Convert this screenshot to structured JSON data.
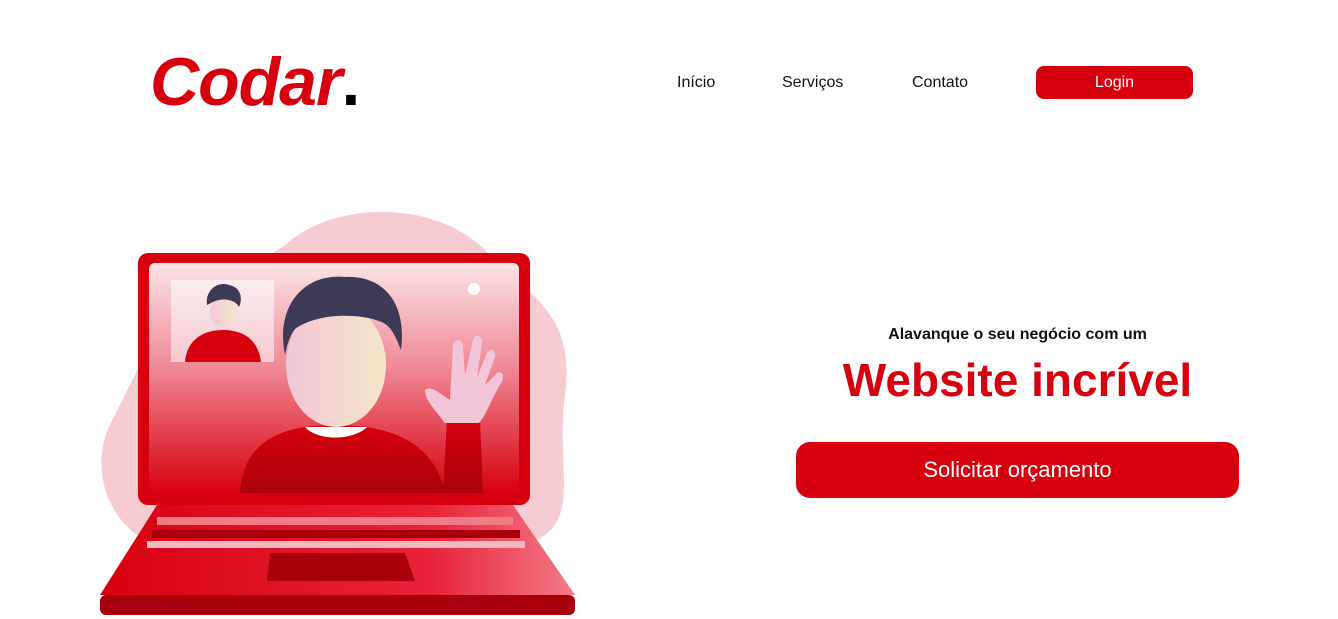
{
  "brand": {
    "name": "Codar",
    "dot": ".",
    "primary_color": "#d7000f"
  },
  "nav": {
    "items": [
      {
        "label": "Início"
      },
      {
        "label": "Serviços"
      },
      {
        "label": "Contato"
      }
    ],
    "login_label": "Login"
  },
  "hero": {
    "tagline": "Alavanque o seu negócio com um",
    "headline": "Website incrível",
    "cta_label": "Solicitar orçamento"
  },
  "illustration": {
    "icon": "video-call-laptop-illustration"
  }
}
